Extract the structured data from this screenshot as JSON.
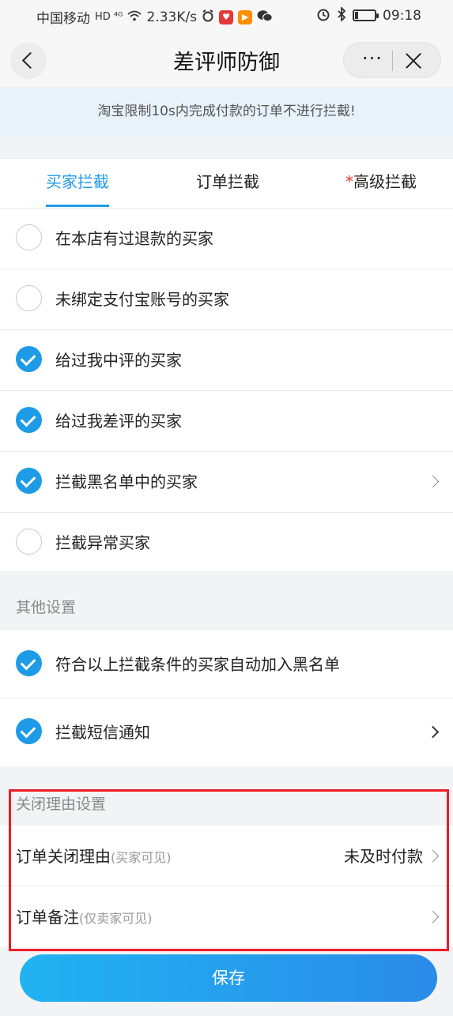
{
  "status_bar": {
    "carrier": "中国移动",
    "network": "HD ⁴ᴳ",
    "speed": "2.33K/s",
    "time": "09:18",
    "battery_level_percent": 15
  },
  "nav": {
    "title": "差评师防御",
    "more_label": "···"
  },
  "notice": {
    "text": "淘宝限制10s内完成付款的订单不进行拦截!"
  },
  "tabs": [
    {
      "label": "买家拦截",
      "active": true,
      "required_mark": ""
    },
    {
      "label": "订单拦截",
      "active": false,
      "required_mark": ""
    },
    {
      "label": "高级拦截",
      "active": false,
      "required_mark": "*"
    }
  ],
  "buyer_rules": [
    {
      "label": "在本店有过退款的买家",
      "checked": false,
      "has_arrow": false
    },
    {
      "label": "未绑定支付宝账号的买家",
      "checked": false,
      "has_arrow": false
    },
    {
      "label": "给过我中评的买家",
      "checked": true,
      "has_arrow": false
    },
    {
      "label": "给过我差评的买家",
      "checked": true,
      "has_arrow": false
    },
    {
      "label": "拦截黑名单中的买家",
      "checked": true,
      "has_arrow": true
    },
    {
      "label": "拦截异常买家",
      "checked": false,
      "has_arrow": false
    }
  ],
  "other_settings": {
    "title": "其他设置",
    "items": [
      {
        "label": "符合以上拦截条件的买家自动加入黑名单",
        "checked": true,
        "has_arrow": false
      },
      {
        "label": "拦截短信通知",
        "checked": true,
        "has_arrow": true
      }
    ]
  },
  "close_reason": {
    "title": "关闭理由设置",
    "reason_label": "订单关闭理由",
    "reason_hint": "(买家可见)",
    "reason_value": "未及时付款",
    "memo_label": "订单备注",
    "memo_hint": "(仅卖家可见)"
  },
  "save_label": "保存",
  "colors": {
    "accent": "#1e9be6",
    "highlight_box": "#ec1c24",
    "notice_bg": "#e8f2fb"
  }
}
